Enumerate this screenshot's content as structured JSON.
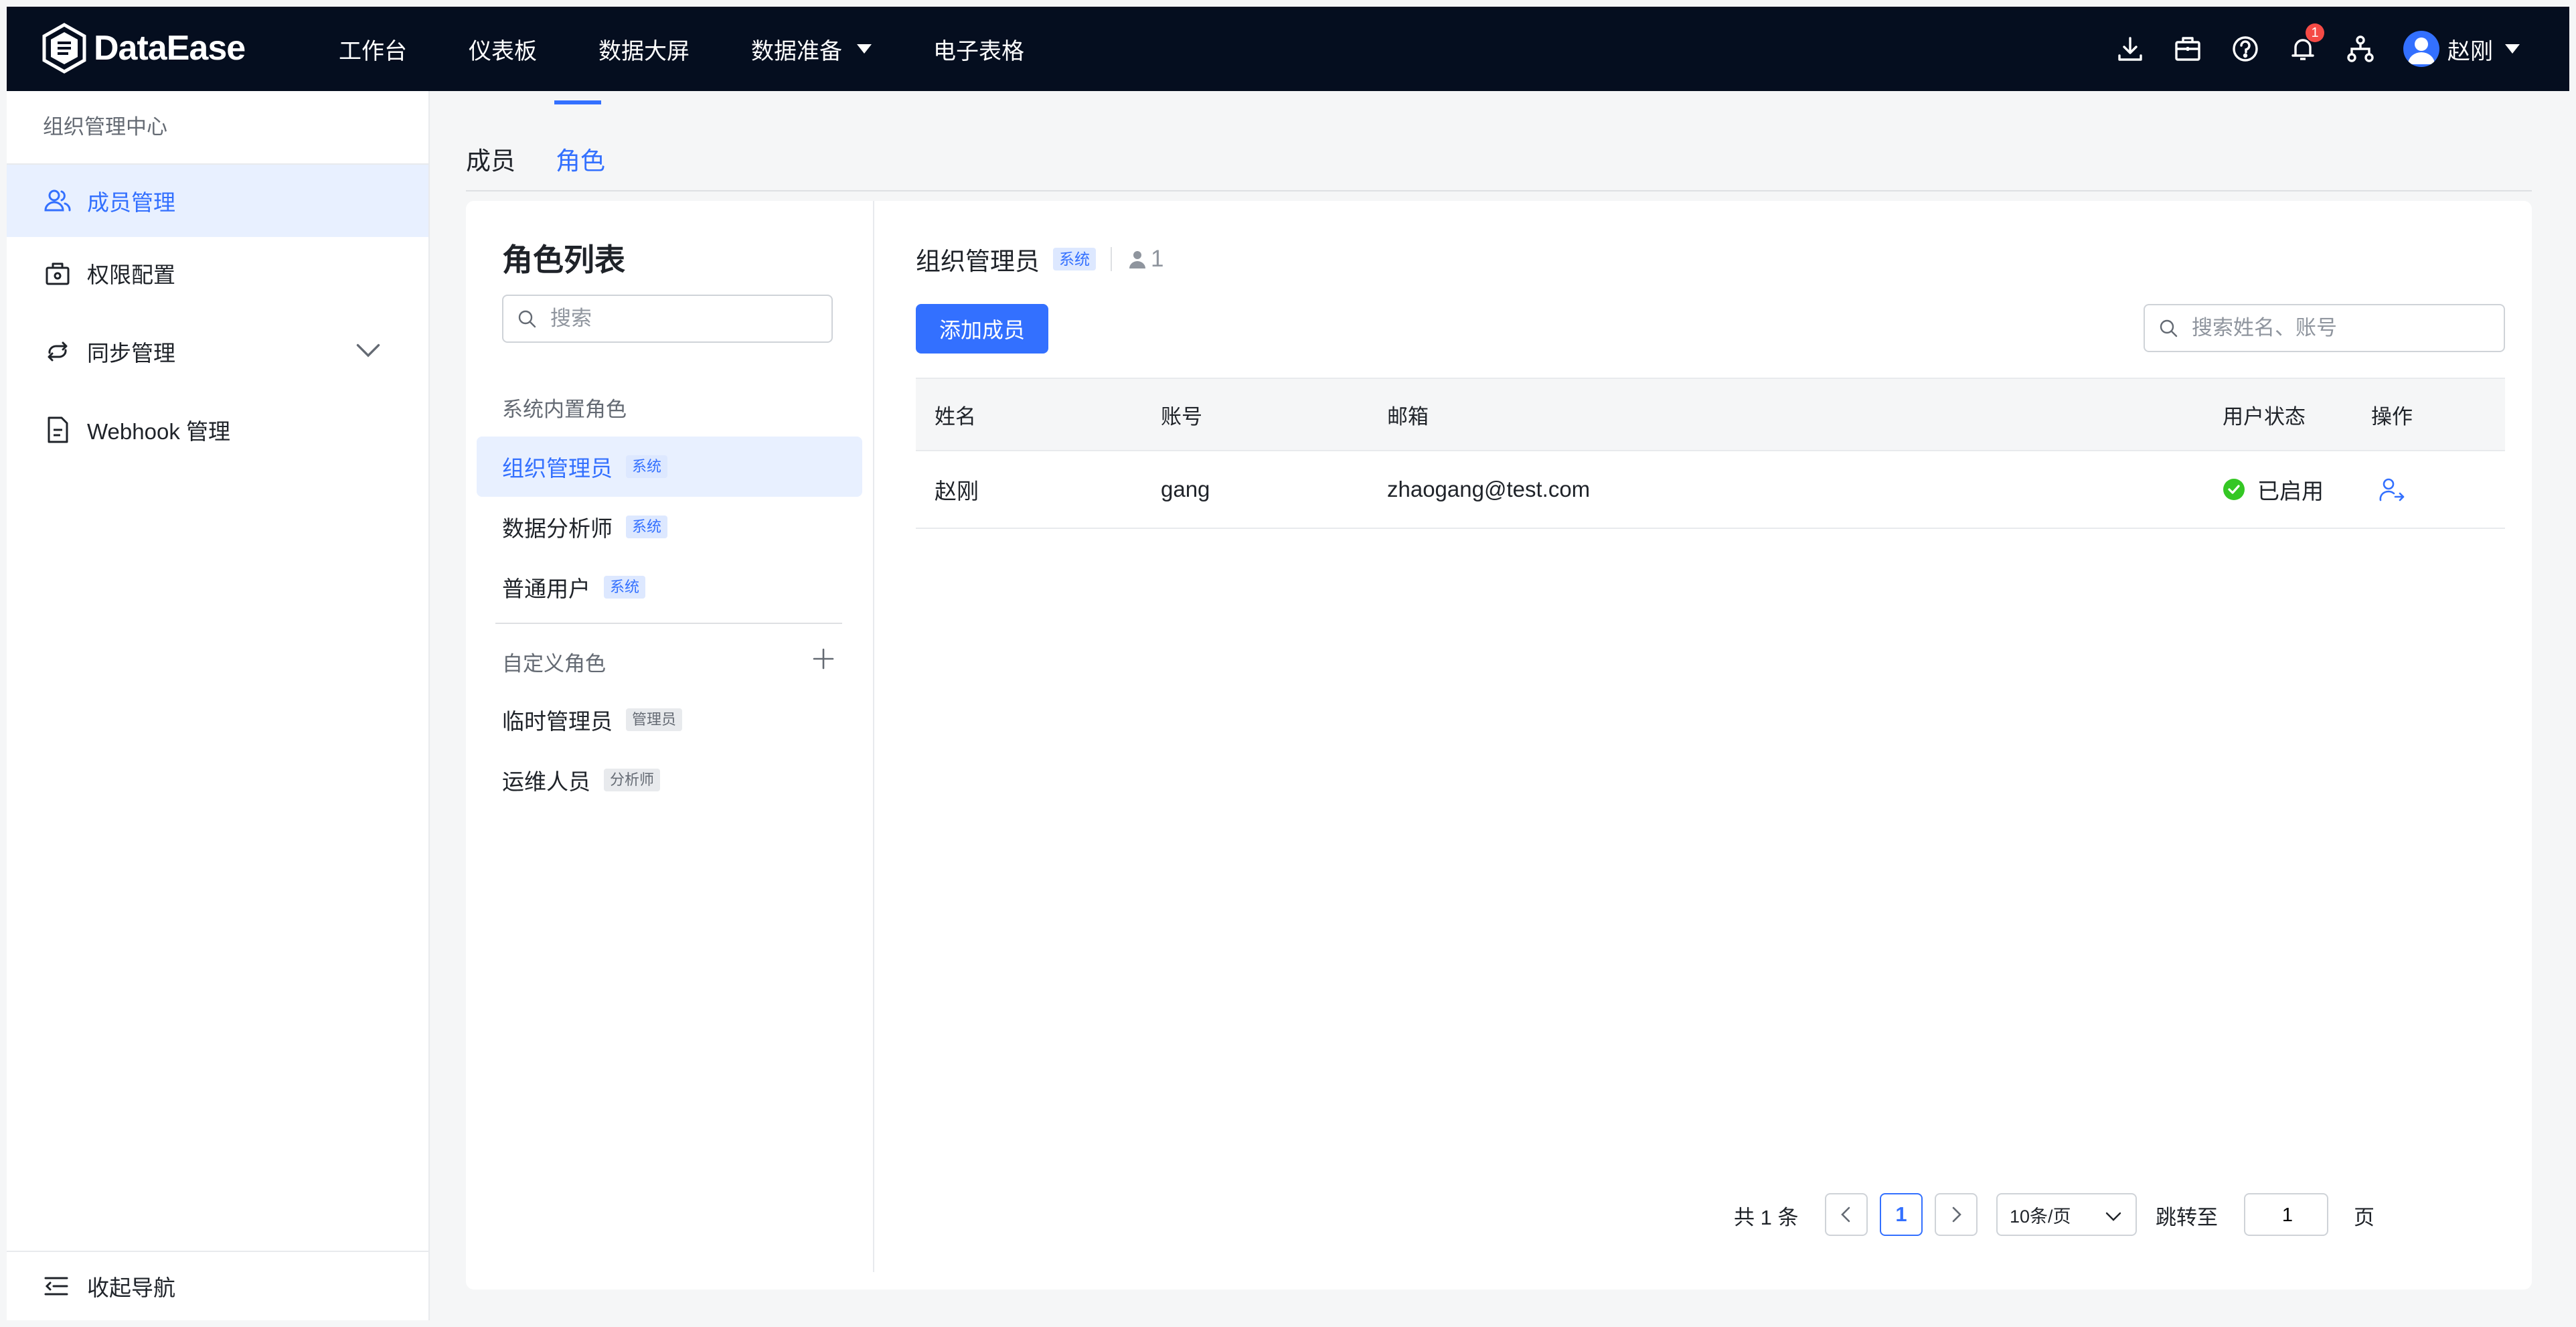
{
  "header": {
    "brand": "DataEase",
    "nav": [
      {
        "label": "工作台"
      },
      {
        "label": "仪表板"
      },
      {
        "label": "数据大屏"
      },
      {
        "label": "数据准备",
        "dropdown": true
      },
      {
        "label": "电子表格"
      }
    ],
    "tools": {
      "icons": [
        "download-icon",
        "briefcase-icon",
        "help-icon",
        "bell-icon",
        "org-tree-icon"
      ],
      "notification_count": "1"
    },
    "user": {
      "name": "赵刚"
    }
  },
  "sidebar": {
    "title": "组织管理中心",
    "items": [
      {
        "label": "成员管理",
        "icon": "users-icon",
        "active": true
      },
      {
        "label": "权限配置",
        "icon": "lock-bag-icon"
      },
      {
        "label": "同步管理",
        "icon": "sync-icon",
        "expandable": true
      },
      {
        "label": "Webhook 管理",
        "icon": "document-icon"
      }
    ],
    "collapse_label": "收起导航"
  },
  "tabs": [
    {
      "label": "成员"
    },
    {
      "label": "角色",
      "active": true
    }
  ],
  "roles": {
    "title": "角色列表",
    "search_placeholder": "搜索",
    "builtin_group": "系统内置角色",
    "builtin": [
      {
        "name": "组织管理员",
        "tag": "系统",
        "active": true
      },
      {
        "name": "数据分析师",
        "tag": "系统"
      },
      {
        "name": "普通用户",
        "tag": "系统"
      }
    ],
    "custom_group": "自定义角色",
    "custom": [
      {
        "name": "临时管理员",
        "tag": "管理员"
      },
      {
        "name": "运维人员",
        "tag": "分析师"
      }
    ]
  },
  "detail": {
    "role_name": "组织管理员",
    "role_tag": "系统",
    "member_count": "1",
    "add_button": "添加成员",
    "search_placeholder": "搜索姓名、账号",
    "columns": [
      "姓名",
      "账号",
      "邮箱",
      "用户状态",
      "操作"
    ],
    "rows": [
      {
        "name": "赵刚",
        "account": "gang",
        "email": "zhaogang@test.com",
        "status": "已启用"
      }
    ]
  },
  "pagination": {
    "total": "共 1 条",
    "current_page": "1",
    "page_size": "10条/页",
    "jump_label": "跳转至",
    "jump_value": "1",
    "page_suffix": "页"
  },
  "colors": {
    "topbar": "#050e1f",
    "accent": "#3370ff",
    "success": "#34c724",
    "badge": "#f54a45"
  }
}
